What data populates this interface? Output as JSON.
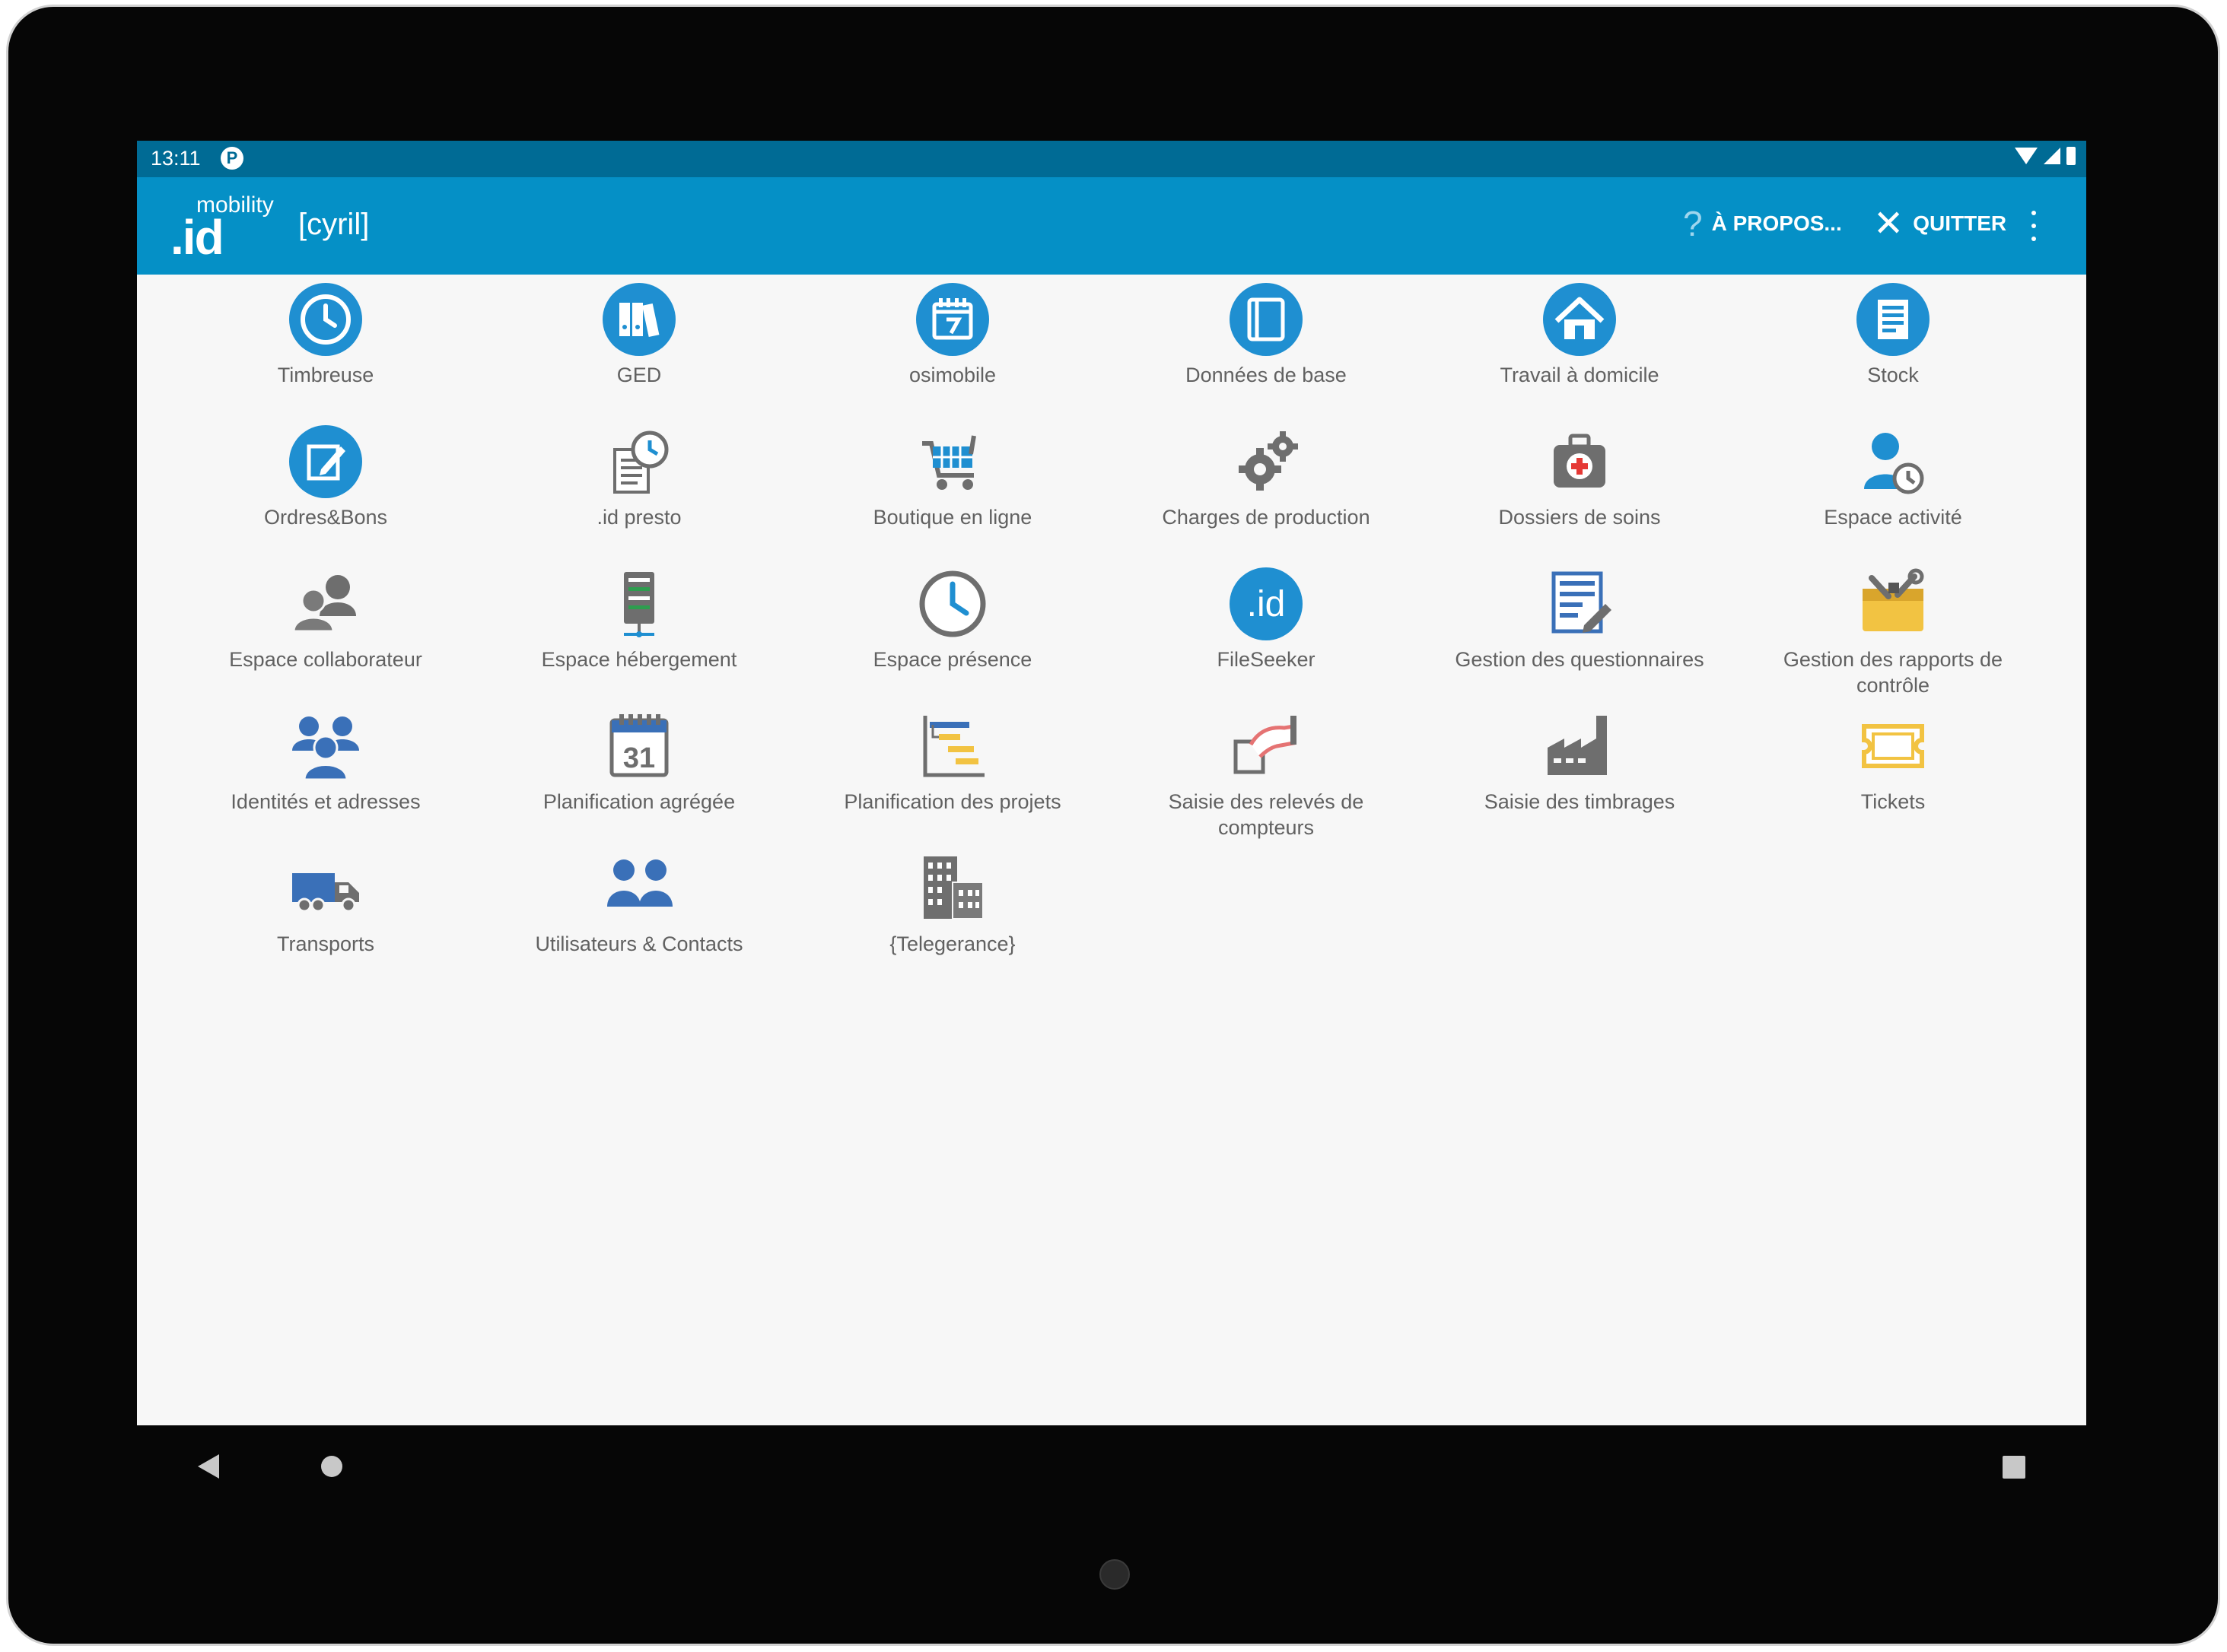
{
  "status_bar": {
    "time": "13:11",
    "notification_icon": "P"
  },
  "app_bar": {
    "logo_small": "mobility",
    "logo_big": ".id",
    "user": "[cyril]",
    "about_icon": "?",
    "about_label": "À PROPOS...",
    "quit_icon": "✕",
    "quit_label": "QUITTER"
  },
  "colors": {
    "status_bar": "#006b95",
    "app_bar": "#0590c6",
    "icon_blue": "#1f8fd1",
    "icon_grey": "#6e6e6e",
    "icon_yellow": "#f2c342"
  },
  "apps": [
    {
      "label": "Timbreuse",
      "icon": "clock-icon"
    },
    {
      "label": "GED",
      "icon": "binders-icon"
    },
    {
      "label": "osimobile",
      "icon": "calendar-icon"
    },
    {
      "label": "Données de base",
      "icon": "book-icon"
    },
    {
      "label": "Travail à domicile",
      "icon": "home-icon"
    },
    {
      "label": "Stock",
      "icon": "clipboard-icon"
    },
    {
      "label": "Ordres&Bons",
      "icon": "pen-edit-icon"
    },
    {
      "label": ".id presto",
      "icon": "notebook-clock-icon"
    },
    {
      "label": "Boutique en ligne",
      "icon": "shopping-cart-icon"
    },
    {
      "label": "Charges de production",
      "icon": "gears-icon"
    },
    {
      "label": "Dossiers de soins",
      "icon": "first-aid-kit-icon"
    },
    {
      "label": "Espace activité",
      "icon": "user-clock-icon"
    },
    {
      "label": "Espace collaborateur",
      "icon": "users-icon"
    },
    {
      "label": "Espace hébergement",
      "icon": "server-icon"
    },
    {
      "label": "Espace présence",
      "icon": "clock-outline-icon"
    },
    {
      "label": "FileSeeker",
      "icon": "id-logo-icon"
    },
    {
      "label": "Gestion des questionnaires",
      "icon": "form-edit-icon"
    },
    {
      "label": "Gestion des rapports de contrôle",
      "icon": "toolbox-icon"
    },
    {
      "label": "Identités et adresses",
      "icon": "people-group-icon"
    },
    {
      "label": "Planification agrégée",
      "icon": "calendar-31-icon"
    },
    {
      "label": "Planification des projets",
      "icon": "gantt-chart-icon"
    },
    {
      "label": "Saisie des relevés de compteurs",
      "icon": "hand-meter-icon"
    },
    {
      "label": "Saisie des timbrages",
      "icon": "factory-icon"
    },
    {
      "label": "Tickets",
      "icon": "ticket-icon"
    },
    {
      "label": "Transports",
      "icon": "truck-icon"
    },
    {
      "label": "Utilisateurs & Contacts",
      "icon": "user-pair-icon"
    },
    {
      "label": "{Telegerance}",
      "icon": "buildings-icon"
    }
  ]
}
